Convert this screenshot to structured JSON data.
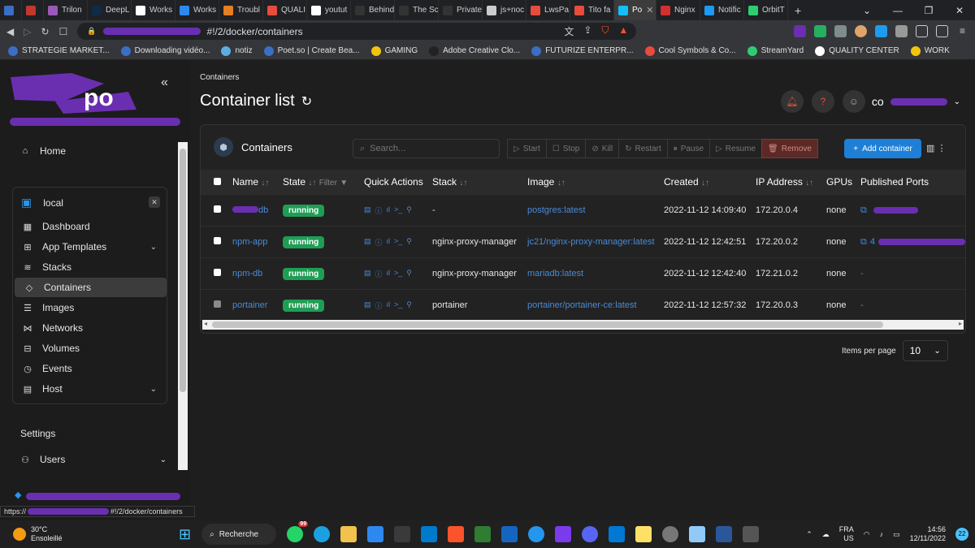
{
  "browser": {
    "tabs": [
      {
        "label": "",
        "color": "#3b6ec4"
      },
      {
        "label": "",
        "color": "#c0392b"
      },
      {
        "label": "Trilon",
        "color": "#9b59b6"
      },
      {
        "label": "DeepL",
        "color": "#0f2b46"
      },
      {
        "label": "Works",
        "color": "#ffffff"
      },
      {
        "label": "Works",
        "color": "#2d89ef"
      },
      {
        "label": "Troubl",
        "color": "#e67e22"
      },
      {
        "label": "QUALI",
        "color": "#e74c3c"
      },
      {
        "label": "youtut",
        "color": "#ffffff"
      },
      {
        "label": "Behind",
        "color": "#333333"
      },
      {
        "label": "The Sc",
        "color": "#333333"
      },
      {
        "label": "Private",
        "color": "#333333"
      },
      {
        "label": "js+noc",
        "color": "#cccccc"
      },
      {
        "label": "LwsPa",
        "color": "#e74c3c"
      },
      {
        "label": "Tito fa",
        "color": "#e74c3c"
      },
      {
        "label": "Po",
        "color": "#13bef9",
        "active": true
      },
      {
        "label": "Nginx",
        "color": "#d32f2f"
      },
      {
        "label": "Notific",
        "color": "#1d9bf0"
      },
      {
        "label": "OrbitT",
        "color": "#2ecc71"
      }
    ],
    "new_tab": "+",
    "url_suffix": "#!/2/docker/containers",
    "bookmarks": [
      {
        "label": "STRATEGIE MARKET...",
        "color": "#3b6ec4"
      },
      {
        "label": "Downloading vidéo...",
        "color": "#3b6ec4"
      },
      {
        "label": "notiz",
        "color": "#5dade2"
      },
      {
        "label": "Poet.so | Create Bea...",
        "color": "#3b6ec4"
      },
      {
        "label": "GAMING",
        "color": "#f1c40f"
      },
      {
        "label": "Adobe Creative Clo...",
        "color": "#222222"
      },
      {
        "label": "FUTURIZE ENTERPR...",
        "color": "#3b6ec4"
      },
      {
        "label": "Cool Symbols & Co...",
        "color": "#e74c3c"
      },
      {
        "label": "StreamYard",
        "color": "#2ecc71"
      },
      {
        "label": "QUALITY CENTER",
        "color": "#ffffff"
      },
      {
        "label": "WORK",
        "color": "#f1c40f"
      }
    ],
    "status_url": "#!/2/docker/containers",
    "status_prefix": "https://"
  },
  "sidebar": {
    "home": "Home",
    "environment": "local",
    "items": [
      {
        "label": "Dashboard",
        "icon": "dashboard-icon",
        "glyph": "▦"
      },
      {
        "label": "App Templates",
        "icon": "rocket-icon",
        "glyph": "⊞",
        "chevron": true
      },
      {
        "label": "Stacks",
        "icon": "layers-icon",
        "glyph": "≋"
      },
      {
        "label": "Containers",
        "icon": "box-icon",
        "glyph": "◇",
        "active": true
      },
      {
        "label": "Images",
        "icon": "list-icon",
        "glyph": "☰"
      },
      {
        "label": "Networks",
        "icon": "network-icon",
        "glyph": "⋈"
      },
      {
        "label": "Volumes",
        "icon": "database-icon",
        "glyph": "⊟"
      },
      {
        "label": "Events",
        "icon": "clock-icon",
        "glyph": "◷"
      },
      {
        "label": "Host",
        "icon": "server-icon",
        "glyph": "▤",
        "chevron": true
      }
    ],
    "settings": "Settings",
    "users": "Users"
  },
  "main": {
    "breadcrumb": "Containers",
    "title": "Container list",
    "panel_title": "Containers",
    "search_placeholder": "Search...",
    "actions": [
      "Start",
      "Stop",
      "Kill",
      "Restart",
      "Pause",
      "Resume",
      "Remove"
    ],
    "add_container": "Add container",
    "columns": [
      "Name",
      "State",
      "Filter",
      "Quick Actions",
      "Stack",
      "Image",
      "Created",
      "IP Address",
      "GPUs",
      "Published Ports"
    ],
    "rows": [
      {
        "name": "db",
        "state": "running",
        "stack": "-",
        "image": "postgres:latest",
        "created": "2022-11-12 14:09:40",
        "ip": "172.20.0.4",
        "gpus": "none",
        "ports": "",
        "redacted_name": true,
        "redacted_ports": true
      },
      {
        "name": "npm-app",
        "state": "running",
        "stack": "nginx-proxy-manager",
        "image": "jc21/nginx-proxy-manager:latest",
        "created": "2022-11-12 12:42:51",
        "ip": "172.20.0.2",
        "gpus": "none",
        "ports": "4",
        "redacted_ports": true
      },
      {
        "name": "npm-db",
        "state": "running",
        "stack": "nginx-proxy-manager",
        "image": "mariadb:latest",
        "created": "2022-11-12 12:42:40",
        "ip": "172.21.0.2",
        "gpus": "none",
        "ports": "-"
      },
      {
        "name": "portainer",
        "state": "running",
        "stack": "portainer",
        "image": "portainer/portainer-ce:latest",
        "created": "2022-11-12 12:57:32",
        "ip": "172.20.0.3",
        "gpus": "none",
        "ports": "-",
        "disabled": true
      }
    ],
    "items_per_page_label": "Items per page",
    "items_per_page": "10"
  },
  "taskbar": {
    "temp": "30°C",
    "weather": "Ensoleillé",
    "search": "Recherche",
    "lang": "FRA",
    "region": "US",
    "time": "14:56",
    "date": "12/11/2022",
    "notif_count": "22",
    "whatsapp_badge": "99"
  }
}
